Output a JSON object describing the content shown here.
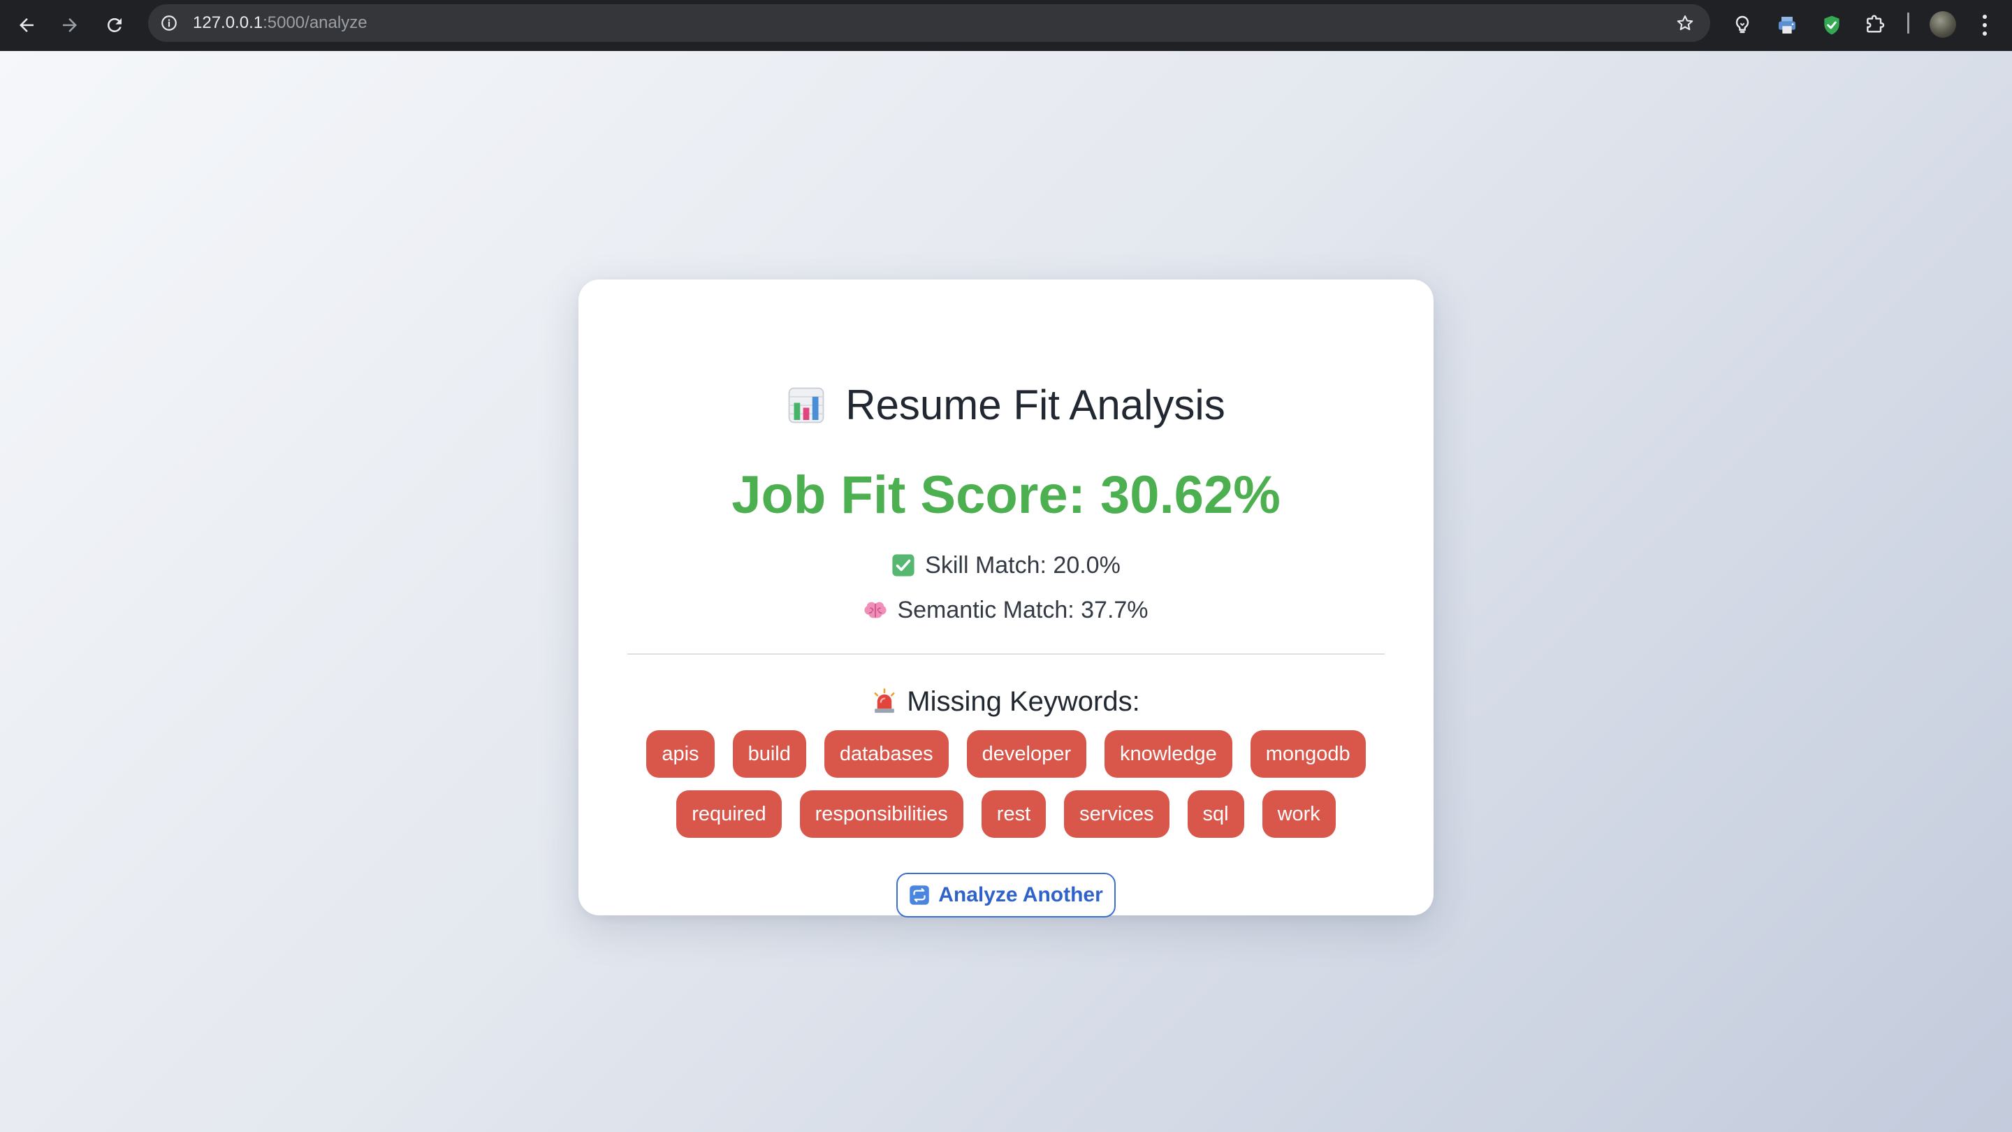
{
  "browser": {
    "url_host": "127.0.0.1",
    "url_path": ":5000/analyze",
    "icons": {
      "back": "back-arrow-icon",
      "forward": "forward-arrow-icon",
      "reload": "reload-icon",
      "site_info": "info-icon",
      "bookmark": "star-icon",
      "extensions": [
        "lightbulb-extension-icon",
        "printer-extension-icon",
        "shield-extension-icon",
        "puzzle-icon"
      ],
      "menu": "kebab-menu-icon"
    }
  },
  "page": {
    "title": "Resume Fit Analysis",
    "title_icon": "bar-chart-icon",
    "score_label": "Job Fit Score: 30.62%",
    "skill_match": "Skill Match: 20.0%",
    "skill_match_icon": "check-box-icon",
    "semantic_match": "Semantic Match: 37.7%",
    "semantic_match_icon": "brain-icon",
    "missing_heading": "Missing Keywords:",
    "missing_icon": "siren-icon",
    "missing_keywords": [
      "apis",
      "build",
      "databases",
      "developer",
      "knowledge",
      "mongodb",
      "required",
      "responsibilities",
      "rest",
      "services",
      "sql",
      "work"
    ],
    "analyze_button": "Analyze Another",
    "analyze_button_icon": "repeat-icon"
  },
  "colors": {
    "score": "#4caf50",
    "tag_background": "#d9574a",
    "button_accent": "#2f63c9"
  }
}
